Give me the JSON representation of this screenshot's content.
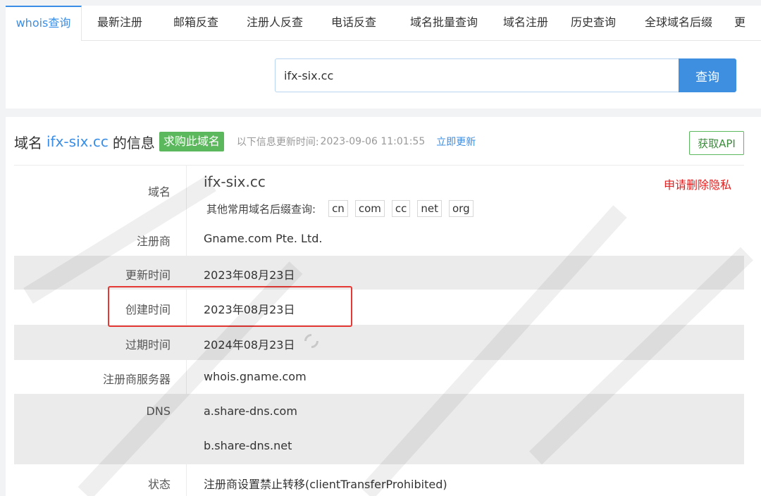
{
  "tabs": [
    "whois查询",
    "最新注册",
    "邮箱反查",
    "注册人反查",
    "电话反查",
    "域名批量查询",
    "域名注册",
    "历史查询",
    "全球域名后缀",
    "更"
  ],
  "search": {
    "value": "ifx-six.cc",
    "button_label": "查询"
  },
  "header": {
    "title_prefix": "域名",
    "domain": "ifx-six.cc",
    "title_suffix": "的信息",
    "buy_label": "求购此域名",
    "update_label": "以下信息更新时间:",
    "update_time": "2023-09-06 11:01:55",
    "update_link": "立即更新",
    "api_button": "获取API"
  },
  "info": {
    "domain_label": "域名",
    "domain_value": "ifx-six.cc",
    "suffix_label": "其他常用域名后缀查询:",
    "suffixes": [
      "cn",
      "com",
      "cc",
      "net",
      "org"
    ],
    "privacy_link": "申请删除隐私",
    "registrar_label": "注册商",
    "registrar_value": "Gname.com Pte. Ltd.",
    "updated_label": "更新时间",
    "updated_value": "2023年08月23日",
    "created_label": "创建时间",
    "created_value": "2023年08月23日",
    "expires_label": "过期时间",
    "expires_value": "2024年08月23日",
    "whois_server_label": "注册商服务器",
    "whois_server_value": "whois.gname.com",
    "dns_label": "DNS",
    "dns_values": [
      "a.share-dns.com",
      "b.share-dns.net"
    ],
    "status_label": "状态",
    "status_value": "注册商设置禁止转移(clientTransferProhibited)"
  },
  "colors": {
    "accent": "#3a8ee6",
    "buy_green": "#5cb85c",
    "highlight_red": "#e53935",
    "privacy_red": "#e02020"
  }
}
